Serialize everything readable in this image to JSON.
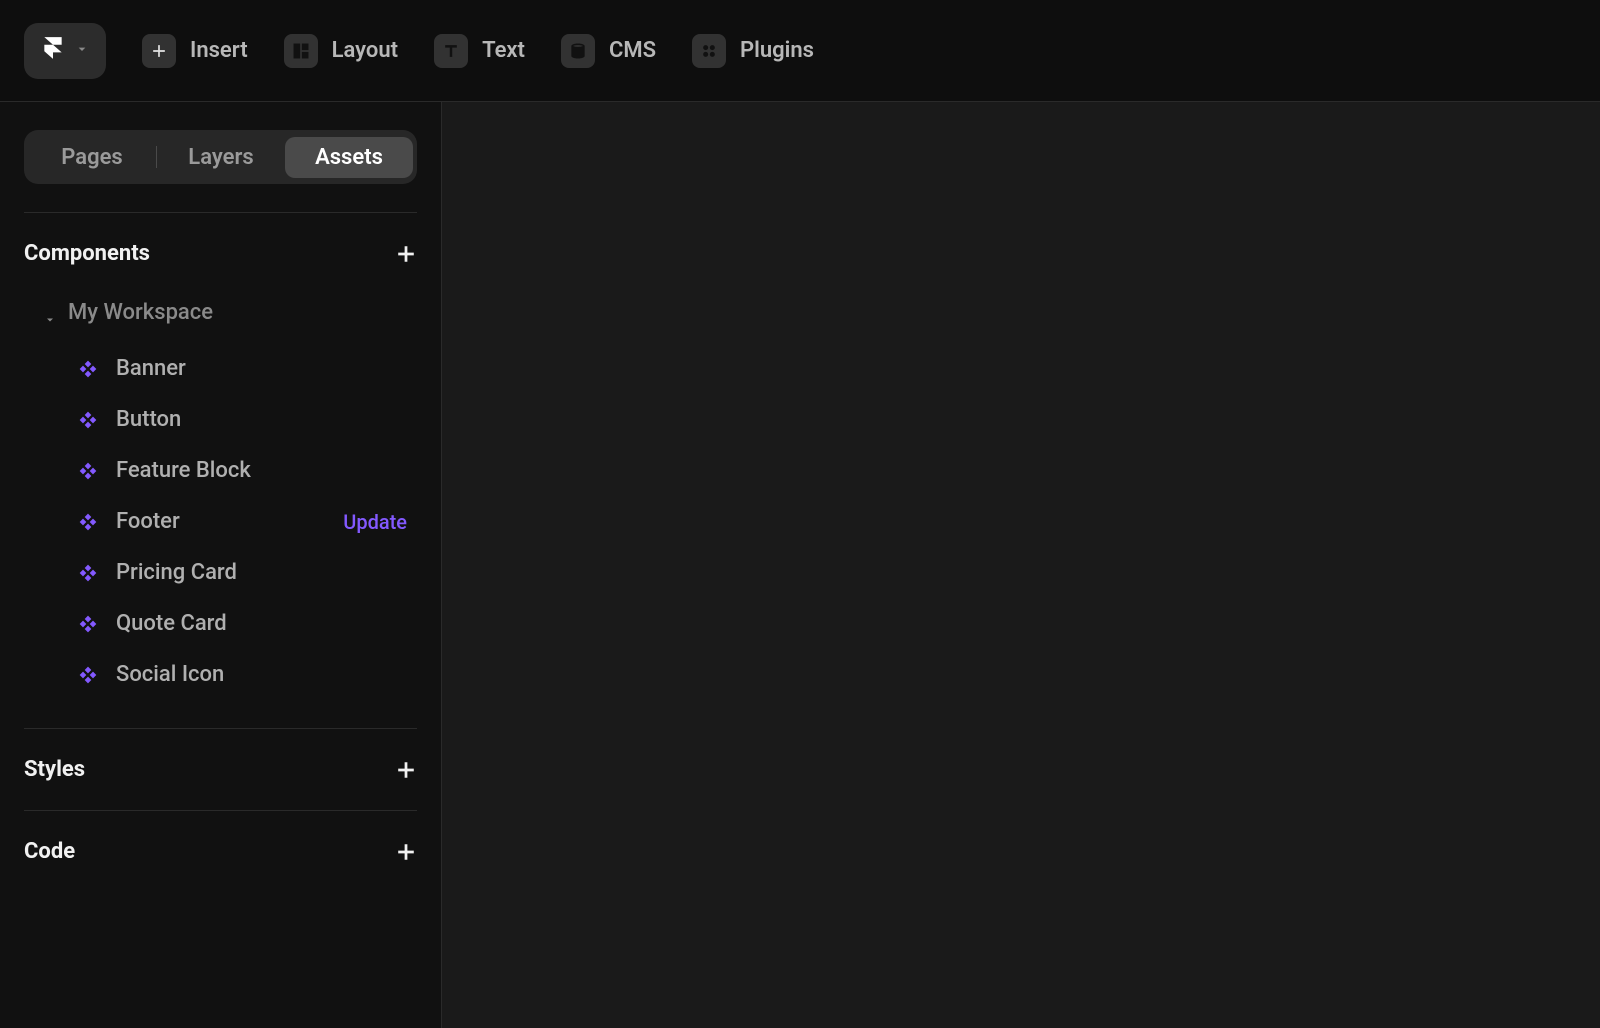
{
  "toolbar": {
    "insert": "Insert",
    "layout": "Layout",
    "text": "Text",
    "cms": "CMS",
    "plugins": "Plugins"
  },
  "sidebar": {
    "tabs": {
      "pages": "Pages",
      "layers": "Layers",
      "assets": "Assets",
      "active": "assets"
    },
    "sections": {
      "components_title": "Components",
      "styles_title": "Styles",
      "code_title": "Code"
    },
    "workspace_label": "My Workspace",
    "update_label": "Update",
    "components": [
      {
        "name": "Banner",
        "update": false
      },
      {
        "name": "Button",
        "update": false
      },
      {
        "name": "Feature Block",
        "update": false
      },
      {
        "name": "Footer",
        "update": true
      },
      {
        "name": "Pricing Card",
        "update": false
      },
      {
        "name": "Quote Card",
        "update": false
      },
      {
        "name": "Social Icon",
        "update": false
      }
    ]
  },
  "colors": {
    "accent": "#8359ff"
  }
}
